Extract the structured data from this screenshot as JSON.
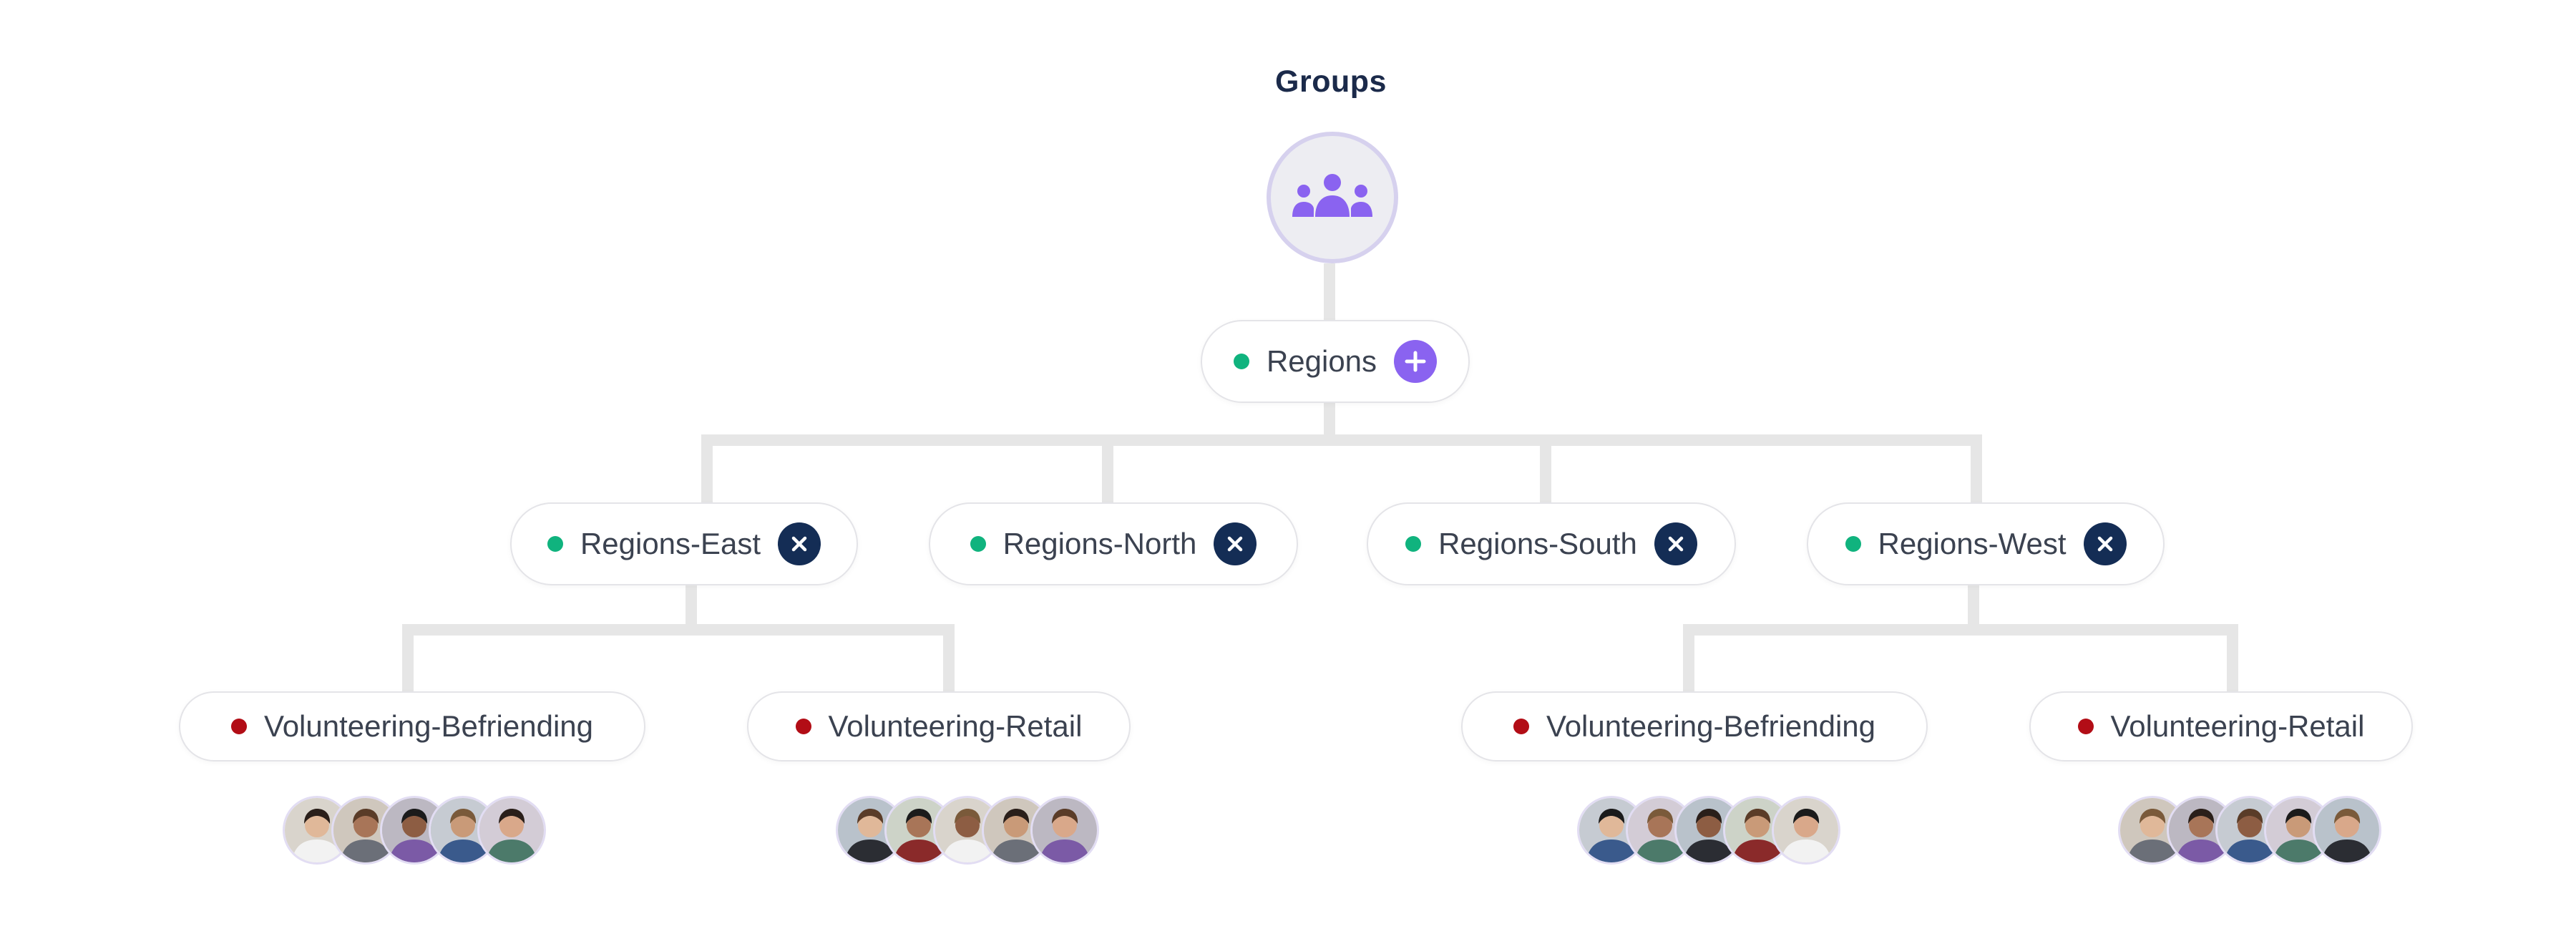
{
  "colors": {
    "active": "#10b37e",
    "inactive": "#b20d16",
    "add_button": "#8a63f0",
    "remove_button": "#142d55",
    "connector": "#e6e6e6"
  },
  "root": {
    "title": "Groups",
    "icon": "users-group-icon"
  },
  "level1": {
    "label": "Regions",
    "status": "active",
    "action_icon": "plus-icon"
  },
  "regions": [
    {
      "label": "Regions-East",
      "status": "active",
      "action_icon": "close-icon"
    },
    {
      "label": "Regions-North",
      "status": "active",
      "action_icon": "close-icon"
    },
    {
      "label": "Regions-South",
      "status": "active",
      "action_icon": "close-icon"
    },
    {
      "label": "Regions-West",
      "status": "active",
      "action_icon": "close-icon"
    }
  ],
  "subgroups": [
    {
      "parent": "Regions-East",
      "label": "Volunteering-Befriending",
      "status": "inactive",
      "member_avatars": 5
    },
    {
      "parent": "Regions-East",
      "label": "Volunteering-Retail",
      "status": "inactive",
      "member_avatars": 5
    },
    {
      "parent": "Regions-West",
      "label": "Volunteering-Befriending",
      "status": "inactive",
      "member_avatars": 5
    },
    {
      "parent": "Regions-West",
      "label": "Volunteering-Retail",
      "status": "inactive",
      "member_avatars": 5
    }
  ]
}
